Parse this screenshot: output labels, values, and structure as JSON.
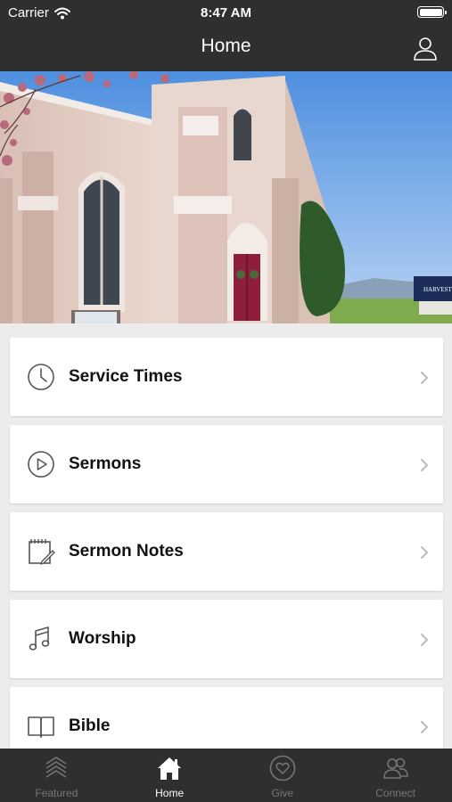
{
  "status_bar": {
    "carrier": "Carrier",
    "time": "8:47 AM"
  },
  "nav": {
    "title": "Home"
  },
  "menu": [
    {
      "label": "Service Times",
      "icon": "clock-icon"
    },
    {
      "label": "Sermons",
      "icon": "play-circle-icon"
    },
    {
      "label": "Sermon Notes",
      "icon": "notepad-icon"
    },
    {
      "label": "Worship",
      "icon": "music-note-icon"
    },
    {
      "label": "Bible",
      "icon": "book-icon"
    }
  ],
  "hero": {
    "sign_text": "HARVEST"
  },
  "tabs": [
    {
      "label": "Featured",
      "icon": "layers-icon",
      "active": false
    },
    {
      "label": "Home",
      "icon": "home-icon",
      "active": true
    },
    {
      "label": "Give",
      "icon": "heart-circle-icon",
      "active": false
    },
    {
      "label": "Connect",
      "icon": "people-icon",
      "active": false
    }
  ],
  "colors": {
    "bar_background": "#2f2f2f",
    "page_background": "#ececec",
    "card_background": "#ffffff",
    "active_tab": "#ffffff",
    "inactive_tab": "#777777"
  }
}
